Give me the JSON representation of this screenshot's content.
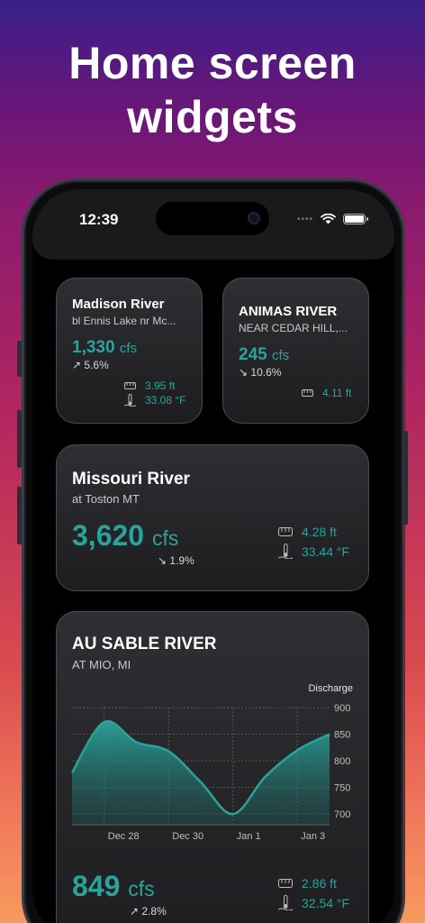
{
  "headline": {
    "line1": "Home screen",
    "line2": "widgets"
  },
  "status": {
    "time": "12:39",
    "dots": "••••"
  },
  "widgets": {
    "madison": {
      "title": "Madison River",
      "subtitle": "bl Ennis Lake nr Mc...",
      "flow_value": "1,330",
      "flow_unit": "cfs",
      "change": "5.6%",
      "change_dir": "up",
      "gauge_height": "3.95 ft",
      "temperature": "33.08 °F"
    },
    "animas": {
      "title": "ANIMAS RIVER",
      "subtitle": "NEAR CEDAR HILL,...",
      "flow_value": "245",
      "flow_unit": "cfs",
      "change": "10.6%",
      "change_dir": "down",
      "gauge_height": "4.11 ft"
    },
    "missouri": {
      "title": "Missouri River",
      "subtitle": "at Toston MT",
      "flow_value": "3,620",
      "flow_unit": "cfs",
      "change": "1.9%",
      "change_dir": "down",
      "gauge_height": "4.28 ft",
      "temperature": "33.44 °F"
    },
    "ausable": {
      "title": "AU SABLE RIVER",
      "subtitle": "AT MIO, MI",
      "flow_value": "849",
      "flow_unit": "cfs",
      "change": "2.8%",
      "change_dir": "up",
      "gauge_height": "2.86 ft",
      "temperature": "32.54 °F"
    }
  },
  "colors": {
    "accent": "#2aa39a",
    "widget_bg": "#26262a"
  },
  "chart_data": {
    "type": "area",
    "title": "",
    "legend": "Discharge",
    "x": [
      "Dec 27",
      "Dec 28",
      "Dec 29",
      "Dec 30",
      "Dec 31",
      "Jan 1",
      "Jan 2",
      "Jan 3",
      "Jan 4"
    ],
    "x_tick_labels": [
      "Dec 28",
      "Dec 30",
      "Jan 1",
      "Jan 3"
    ],
    "series": [
      {
        "name": "Discharge",
        "values": [
          778,
          873,
          835,
          818,
          760,
          700,
          770,
          820,
          850
        ]
      }
    ],
    "yticks": [
      "900",
      "850",
      "800",
      "750",
      "700"
    ],
    "ylim": [
      680,
      900
    ],
    "grid": true
  }
}
